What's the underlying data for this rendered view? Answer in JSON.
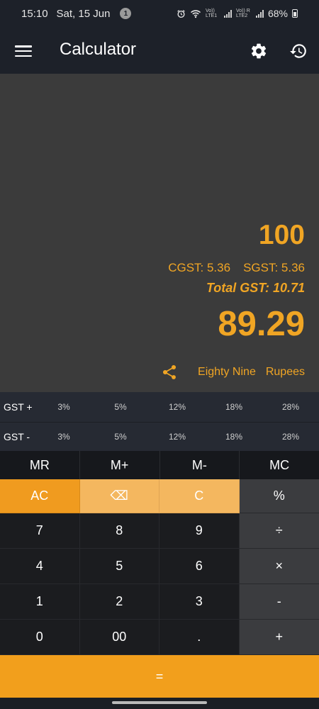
{
  "status_bar": {
    "time": "15:10",
    "date": "Sat, 15 Jun",
    "notification_count": "1",
    "sim1": "Vo)) LTE1",
    "sim2": "Vo)) R LTE2",
    "battery": "68%"
  },
  "app_bar": {
    "title": "Calculator"
  },
  "display": {
    "input_value": "100",
    "cgst": "CGST: 5.36",
    "sgst": "SGST: 5.36",
    "total_gst": "Total GST: 10.71",
    "result": "89.29",
    "words": [
      "Eighty Nine",
      "Rupees"
    ],
    "accent_color": "#f0a524"
  },
  "gst_rows": [
    {
      "label": "GST +",
      "rates": [
        "3%",
        "5%",
        "12%",
        "18%",
        "28%"
      ]
    },
    {
      "label": "GST -",
      "rates": [
        "3%",
        "5%",
        "12%",
        "18%",
        "28%"
      ]
    }
  ],
  "memory": [
    "MR",
    "M+",
    "M-",
    "MC"
  ],
  "keys": {
    "ac": "AC",
    "backspace": "⌫",
    "clear": "C",
    "percent": "%",
    "divide": "÷",
    "multiply": "×",
    "minus": "-",
    "plus": "+",
    "equals": "=",
    "digits": [
      "7",
      "8",
      "9",
      "4",
      "5",
      "6",
      "1",
      "2",
      "3",
      "0",
      "00",
      "."
    ]
  }
}
